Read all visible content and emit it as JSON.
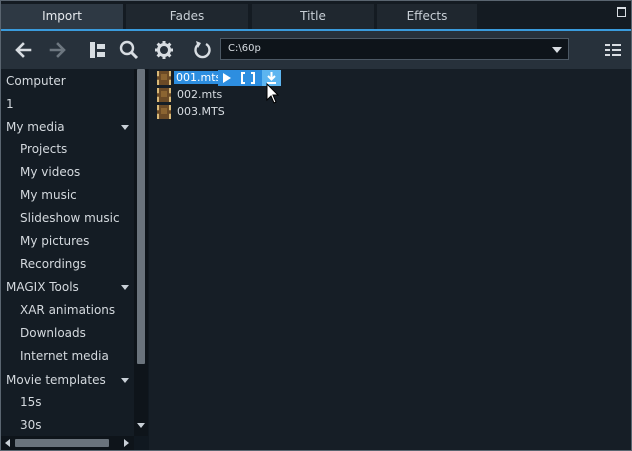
{
  "tabs": [
    {
      "label": "Import",
      "active": true
    },
    {
      "label": "Fades",
      "active": false
    },
    {
      "label": "Title",
      "active": false
    },
    {
      "label": "Effects",
      "active": false
    }
  ],
  "toolbar": {
    "icons": [
      "back-arrow-icon",
      "forward-arrow-icon",
      "folder-tree-icon",
      "search-icon",
      "gear-icon",
      "refresh-icon",
      "list-view-icon"
    ],
    "path": "C:\\60p"
  },
  "sidebar": {
    "items": [
      {
        "label": "Computer",
        "level": 0
      },
      {
        "label": "1",
        "level": 0
      },
      {
        "label": "My media",
        "level": 0,
        "expandable": true
      },
      {
        "label": "Projects",
        "level": 1
      },
      {
        "label": "My videos",
        "level": 1
      },
      {
        "label": "My music",
        "level": 1
      },
      {
        "label": "Slideshow music",
        "level": 1
      },
      {
        "label": "My pictures",
        "level": 1
      },
      {
        "label": "Recordings",
        "level": 1
      },
      {
        "label": "MAGIX Tools",
        "level": 0,
        "expandable": true
      },
      {
        "label": "XAR animations",
        "level": 1
      },
      {
        "label": "Downloads",
        "level": 1
      },
      {
        "label": "Internet media",
        "level": 1
      },
      {
        "label": "Movie templates",
        "level": 0,
        "expandable": true
      },
      {
        "label": "15s",
        "level": 1
      },
      {
        "label": "30s",
        "level": 1
      }
    ]
  },
  "files": [
    {
      "name": "001.mts",
      "selected": true
    },
    {
      "name": "002.mts",
      "selected": false
    },
    {
      "name": "003.MTS",
      "selected": false
    }
  ],
  "colors": {
    "accent": "#3a9bdc",
    "selection": "#2d8ee0",
    "background": "#101820"
  }
}
